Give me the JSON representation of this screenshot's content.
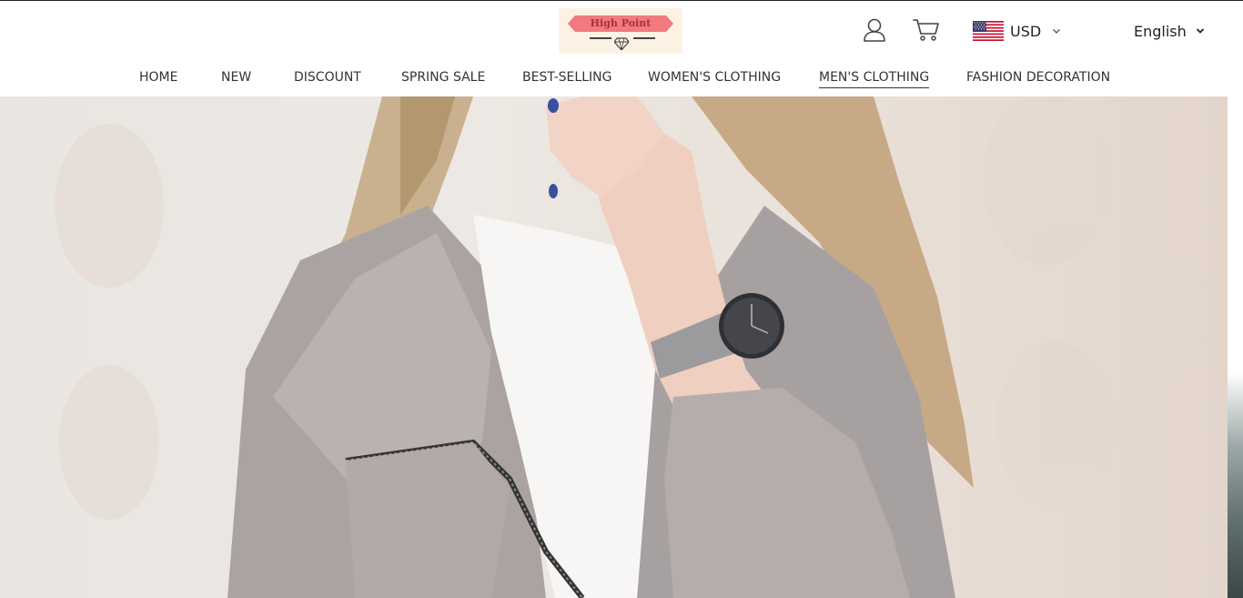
{
  "header": {
    "logo": {
      "text": "High Point",
      "icon": "diamond-icon"
    },
    "icons": {
      "account": "user-icon",
      "cart": "cart-icon"
    },
    "currency": {
      "flag": "us-flag-icon",
      "code": "USD"
    },
    "language": {
      "label": "English"
    }
  },
  "nav": {
    "items": [
      {
        "label": "HOME"
      },
      {
        "label": "NEW"
      },
      {
        "label": "DISCOUNT"
      },
      {
        "label": "SPRING SALE"
      },
      {
        "label": "BEST-SELLING"
      },
      {
        "label": "WOMEN'S CLOTHING"
      },
      {
        "label": "MEN'S CLOTHING",
        "active": true
      },
      {
        "label": "FASHION DECORATION"
      }
    ]
  },
  "hero": {
    "image": "woman-in-grey-jacket-wearing-watch-photo"
  },
  "colors": {
    "logo_banner": "#f07a7f",
    "logo_bg": "#fdf1e4",
    "text": "#333333"
  }
}
